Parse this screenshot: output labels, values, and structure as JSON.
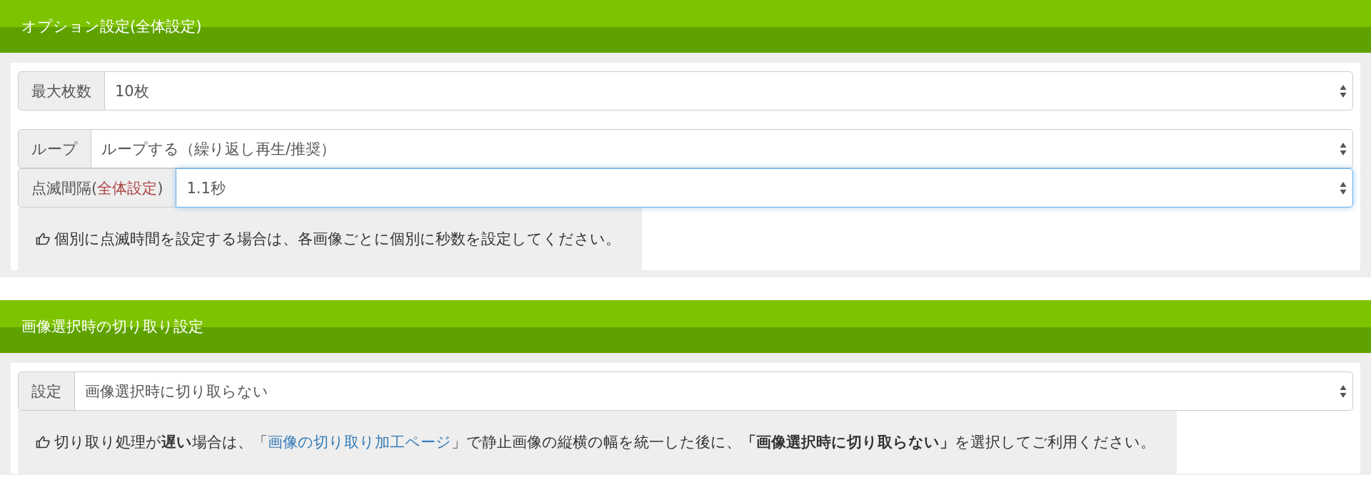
{
  "sections": [
    {
      "title": "オプション設定(全体設定)",
      "rows": [
        {
          "label": [
            {
              "kind": "plain",
              "text": "最大枚数"
            }
          ],
          "value": "10枚",
          "focused": false,
          "spaced": true
        },
        {
          "label": [
            {
              "kind": "plain",
              "text": "ループ"
            }
          ],
          "value": "ループする（繰り返し再生/推奨）",
          "focused": false,
          "spaced": false
        },
        {
          "label": [
            {
              "kind": "plain",
              "text": "点滅間隔("
            },
            {
              "kind": "accent",
              "text": "全体設定"
            },
            {
              "kind": "plain",
              "text": ")"
            }
          ],
          "value": "1.1秒",
          "focused": true,
          "spaced": false
        }
      ],
      "note": [
        {
          "kind": "text",
          "text": "個別に点滅時間を設定する場合は、各画像ごとに個別に秒数を設定してください。"
        }
      ]
    },
    {
      "title": "画像選択時の切り取り設定",
      "rows": [
        {
          "label": [
            {
              "kind": "plain",
              "text": "設定"
            }
          ],
          "value": "画像選択時に切り取らない",
          "focused": false,
          "spaced": false
        }
      ],
      "note": [
        {
          "kind": "text",
          "text": "切り取り処理が**遅い**場合は、「"
        },
        {
          "kind": "link",
          "text": "画像の切り取り加工ページ"
        },
        {
          "kind": "text",
          "text": "」で静止画像の縦横の幅を統一した後に、**「画像選択時に切り取らない」**を選択してご利用ください。"
        }
      ]
    }
  ]
}
